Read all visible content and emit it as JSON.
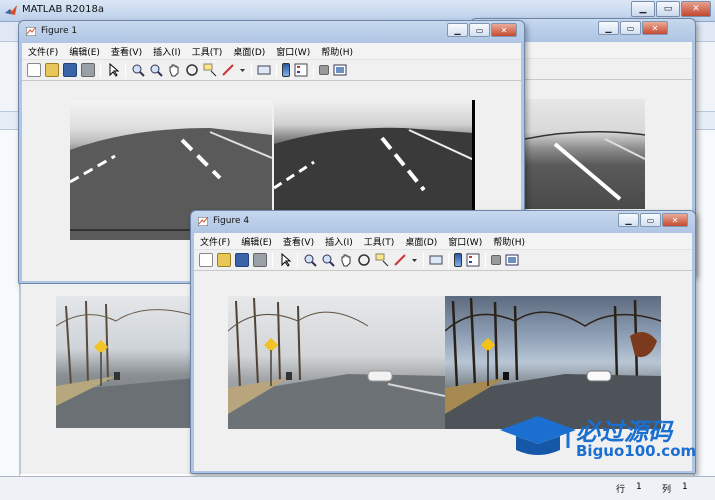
{
  "app": {
    "title": "MATLAB R2018a"
  },
  "colors": {
    "accent": "#c0472e",
    "titlebar": "#bcd0ea",
    "watermark_blue": "#1b6fd0"
  },
  "figure1": {
    "title": "Figure 1",
    "menu": [
      "文件(F)",
      "编辑(E)",
      "查看(V)",
      "插入(I)",
      "工具(T)",
      "桌面(D)",
      "窗口(W)",
      "帮助(H)"
    ]
  },
  "figure4": {
    "title": "Figure 4",
    "menu": [
      "文件(F)",
      "编辑(E)",
      "查看(V)",
      "插入(I)",
      "工具(T)",
      "桌面(D)",
      "窗口(W)",
      "帮助(H)"
    ]
  },
  "toolbar_icons": [
    "new-file-icon",
    "open-folder-icon",
    "save-icon",
    "print-icon",
    "pointer-icon",
    "zoom-in-icon",
    "zoom-out-icon",
    "pan-hand-icon",
    "rotate-3d-icon",
    "data-cursor-icon",
    "brush-icon",
    "link-plot-icon",
    "colorbar-icon",
    "legend-icon",
    "hide-plot-tools-icon",
    "show-plot-tools-icon"
  ],
  "status": {
    "row_label": "行",
    "row_value": "1",
    "col_label": "列",
    "col_value": "1"
  },
  "watermark": {
    "title": "必过源码",
    "url": "Biguo100.com"
  }
}
